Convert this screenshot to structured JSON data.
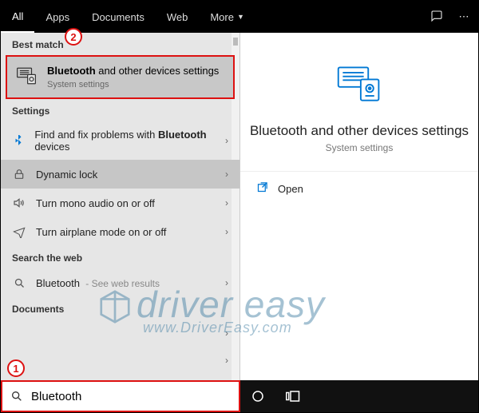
{
  "tabs": {
    "all": "All",
    "apps": "Apps",
    "documents": "Documents",
    "web": "Web",
    "more": "More"
  },
  "left": {
    "best_match_hdr": "Best match",
    "best_match": {
      "title_pre": "Bluetooth",
      "title_post": " and other devices settings",
      "sub": "System settings"
    },
    "settings_hdr": "Settings",
    "settings": [
      {
        "pre": "Find and fix problems with ",
        "bold": "Bluetooth",
        "post": " devices"
      },
      {
        "pre": "Dynamic lock",
        "bold": "",
        "post": ""
      },
      {
        "pre": "Turn mono audio on or off",
        "bold": "",
        "post": ""
      },
      {
        "pre": "Turn airplane mode on or off",
        "bold": "",
        "post": ""
      }
    ],
    "search_web_hdr": "Search the web",
    "search_web_item": "Bluetooth",
    "search_web_sub": " - See web results",
    "documents_hdr": "Documents"
  },
  "right": {
    "title": "Bluetooth and other devices settings",
    "sub": "System settings",
    "open": "Open"
  },
  "taskbar": {
    "search_value": "Bluetooth"
  },
  "annotations": {
    "a1": "1",
    "a2": "2"
  },
  "watermark": {
    "l1": "driver easy",
    "l2": "www.DriverEasy.com"
  }
}
